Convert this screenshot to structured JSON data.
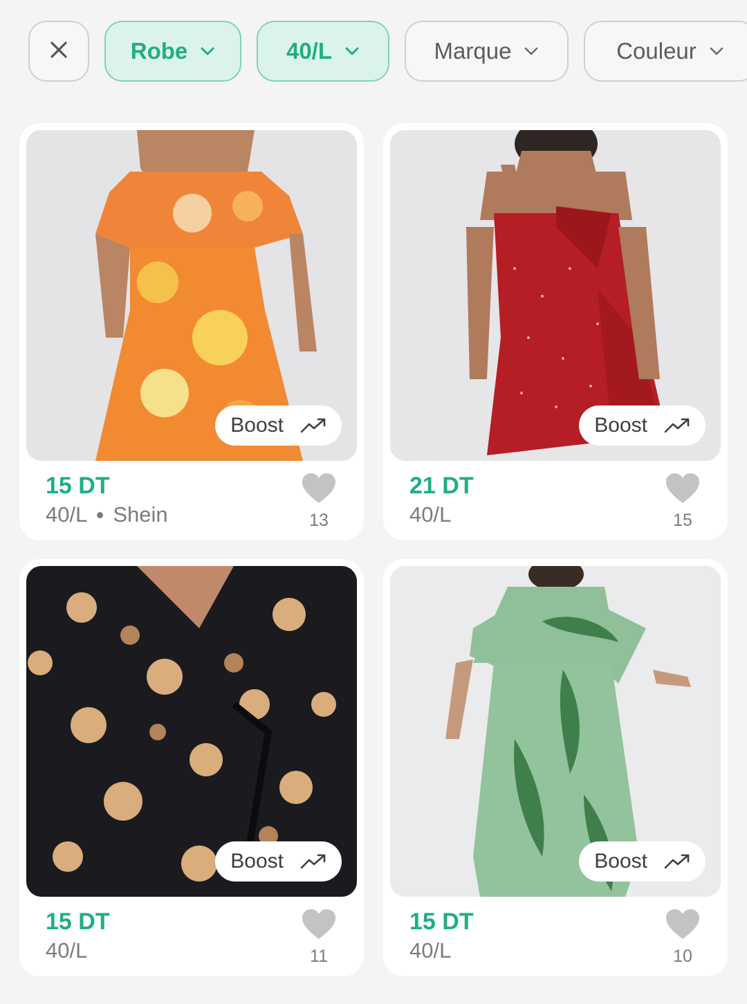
{
  "filters": {
    "close_icon": "close-icon",
    "chips": [
      {
        "label": "Robe",
        "active": true
      },
      {
        "label": "40/L",
        "active": true
      },
      {
        "label": "Marque",
        "active": false
      },
      {
        "label": "Couleur",
        "active": false
      }
    ]
  },
  "colors": {
    "accent": "#1fae84",
    "chip_active_bg": "#dcf3ea",
    "page_bg": "#f4f4f5"
  },
  "products": [
    {
      "price": "15 DT",
      "size": "40/L",
      "brand": "Shein",
      "likes": "13",
      "boost_label": "Boost",
      "image": "orange floral off-shoulder dress"
    },
    {
      "price": "21 DT",
      "size": "40/L",
      "brand": "",
      "likes": "15",
      "boost_label": "Boost",
      "image": "red polka-dot ruffle wrap dress"
    },
    {
      "price": "15 DT",
      "size": "40/L",
      "brand": "",
      "likes": "11",
      "boost_label": "Boost",
      "image": "black wrap dress with beige flowers"
    },
    {
      "price": "15 DT",
      "size": "40/L",
      "brand": "",
      "likes": "10",
      "boost_label": "Boost",
      "image": "green leaf-print midi dress"
    }
  ]
}
